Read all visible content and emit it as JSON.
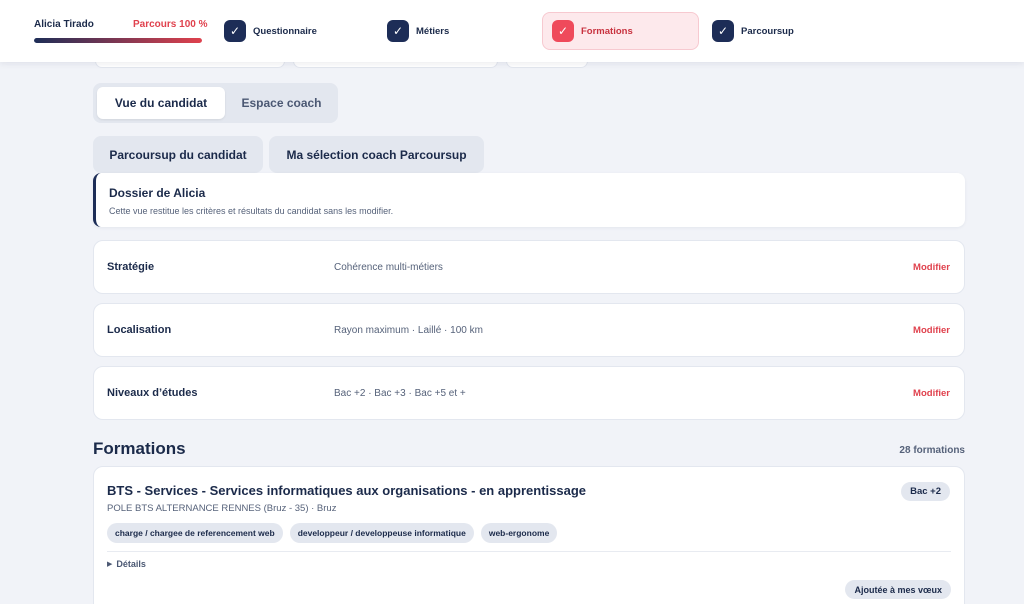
{
  "header": {
    "user_name": "Alicia Tirado",
    "progress_label": "Parcours 100 %",
    "progress_value": 1.0,
    "steps": [
      {
        "label": "Questionnaire",
        "icon": "check-icon",
        "state": "done"
      },
      {
        "label": "Métiers",
        "icon": "check-icon",
        "state": "done"
      },
      {
        "label": "Formations",
        "icon": "check-icon",
        "state": "current"
      },
      {
        "label": "Parcoursup",
        "icon": "check-icon",
        "state": "done"
      }
    ],
    "check_glyph": "✓"
  },
  "view_switch": {
    "active": "Vue du candidat",
    "other": "Espace coach"
  },
  "subtabs": [
    "Parcoursup du candidat",
    "Ma sélection coach Parcoursup"
  ],
  "info": {
    "title": "Dossier de Alicia",
    "subtitle": "Cette vue restitue les critères et résultats du candidat sans les modifier."
  },
  "criteria": [
    {
      "label": "Stratégie",
      "value": "Cohérence multi-métiers",
      "action": "Modifier"
    },
    {
      "label": "Localisation",
      "value": "Rayon maximum · Laillé · 100 km",
      "action": "Modifier"
    },
    {
      "label": "Niveaux d’études",
      "value": "Bac +2 · Bac +3 · Bac +5 et +",
      "action": "Modifier"
    }
  ],
  "formations": {
    "title": "Formations",
    "count": "28 formations",
    "items": [
      {
        "title": "BTS - Services - Services informatiques aux organisations - en apprentissage",
        "level": "Bac +2",
        "school": "POLE BTS ALTERNANCE RENNES (Bruz - 35) · Bruz",
        "tags": [
          "charge / chargee de referencement web",
          "developpeur / developpeuse informatique",
          "web-ergonome"
        ],
        "details_label": "Détails",
        "details_glyph": "▶",
        "status": "Ajoutée à mes vœux"
      }
    ]
  },
  "colors": {
    "brand_navy": "#1d2d57",
    "accent_red": "#e0414d",
    "background": "#f1f3f8"
  }
}
